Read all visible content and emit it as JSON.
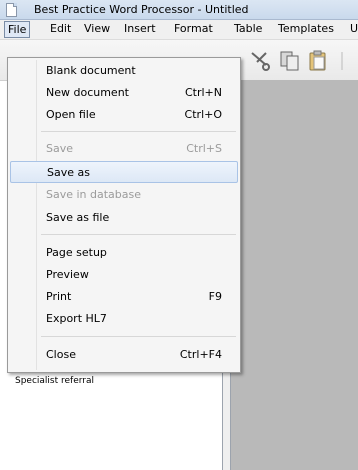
{
  "window": {
    "title": "Best Practice Word Processor - Untitled"
  },
  "menubar": {
    "items": [
      {
        "label": "File"
      },
      {
        "label": "Edit"
      },
      {
        "label": "View"
      },
      {
        "label": "Insert"
      },
      {
        "label": "Format"
      },
      {
        "label": "Table"
      },
      {
        "label": "Templates"
      },
      {
        "label": "U"
      }
    ]
  },
  "file_menu": {
    "items": [
      {
        "label": "Blank document",
        "shortcut": ""
      },
      {
        "label": "New document",
        "shortcut": "Ctrl+N"
      },
      {
        "label": "Open file",
        "shortcut": "Ctrl+O"
      },
      {
        "label": "Save",
        "shortcut": "Ctrl+S"
      },
      {
        "label": "Save as",
        "shortcut": ""
      },
      {
        "label": "Save in database",
        "shortcut": ""
      },
      {
        "label": "Save as file",
        "shortcut": ""
      },
      {
        "label": "Page setup",
        "shortcut": ""
      },
      {
        "label": "Preview",
        "shortcut": ""
      },
      {
        "label": "Print",
        "shortcut": "F9"
      },
      {
        "label": "Export HL7",
        "shortcut": ""
      },
      {
        "label": "Close",
        "shortcut": "Ctrl+F4"
      }
    ]
  },
  "left_panel": {
    "item": "Specialist referral"
  },
  "toolbar": {
    "icons": [
      "cut-icon",
      "copy-icon",
      "paste-icon"
    ]
  },
  "colors": {
    "menu_hover": "#dde8f6",
    "disabled_text": "#9b9b9b",
    "editor_background": "#b9b9b9"
  }
}
